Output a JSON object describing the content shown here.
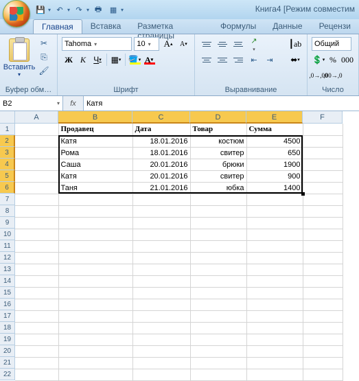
{
  "title": "Книга4  [Режим совместим",
  "tabs": [
    "Главная",
    "Вставка",
    "Разметка страницы",
    "Формулы",
    "Данные",
    "Рецензи"
  ],
  "ribbon": {
    "clipboard": {
      "paste": "Вставить",
      "label": "Буфер обм…"
    },
    "font": {
      "name": "Tahoma",
      "size": "10",
      "label": "Шрифт",
      "bold": "Ж",
      "italic": "К",
      "underline": "Ч"
    },
    "alignment": {
      "label": "Выравнивание"
    },
    "number": {
      "label": "Число",
      "format": "Общий"
    }
  },
  "namebox": "B2",
  "fx": "fx",
  "formula": "Катя",
  "cols": [
    "A",
    "B",
    "C",
    "D",
    "E",
    "F"
  ],
  "rows": [
    "1",
    "2",
    "3",
    "4",
    "5",
    "6",
    "7",
    "8",
    "9",
    "10",
    "11",
    "12",
    "13",
    "14",
    "15",
    "16",
    "17",
    "18",
    "19",
    "20",
    "21",
    "22"
  ],
  "headers": {
    "b": "Продавец",
    "c": "Дата",
    "d": "Товар",
    "e": "Сумма"
  },
  "data": [
    {
      "b": "Катя",
      "c": "18.01.2016",
      "d": "костюм",
      "e": "4500"
    },
    {
      "b": "Рома",
      "c": "18.01.2016",
      "d": "свитер",
      "e": "650"
    },
    {
      "b": "Саша",
      "c": "20.01.2016",
      "d": "брюки",
      "e": "1900"
    },
    {
      "b": "Катя",
      "c": "20.01.2016",
      "d": "свитер",
      "e": "900"
    },
    {
      "b": "Таня",
      "c": "21.01.2016",
      "d": "юбка",
      "e": "1400"
    }
  ]
}
